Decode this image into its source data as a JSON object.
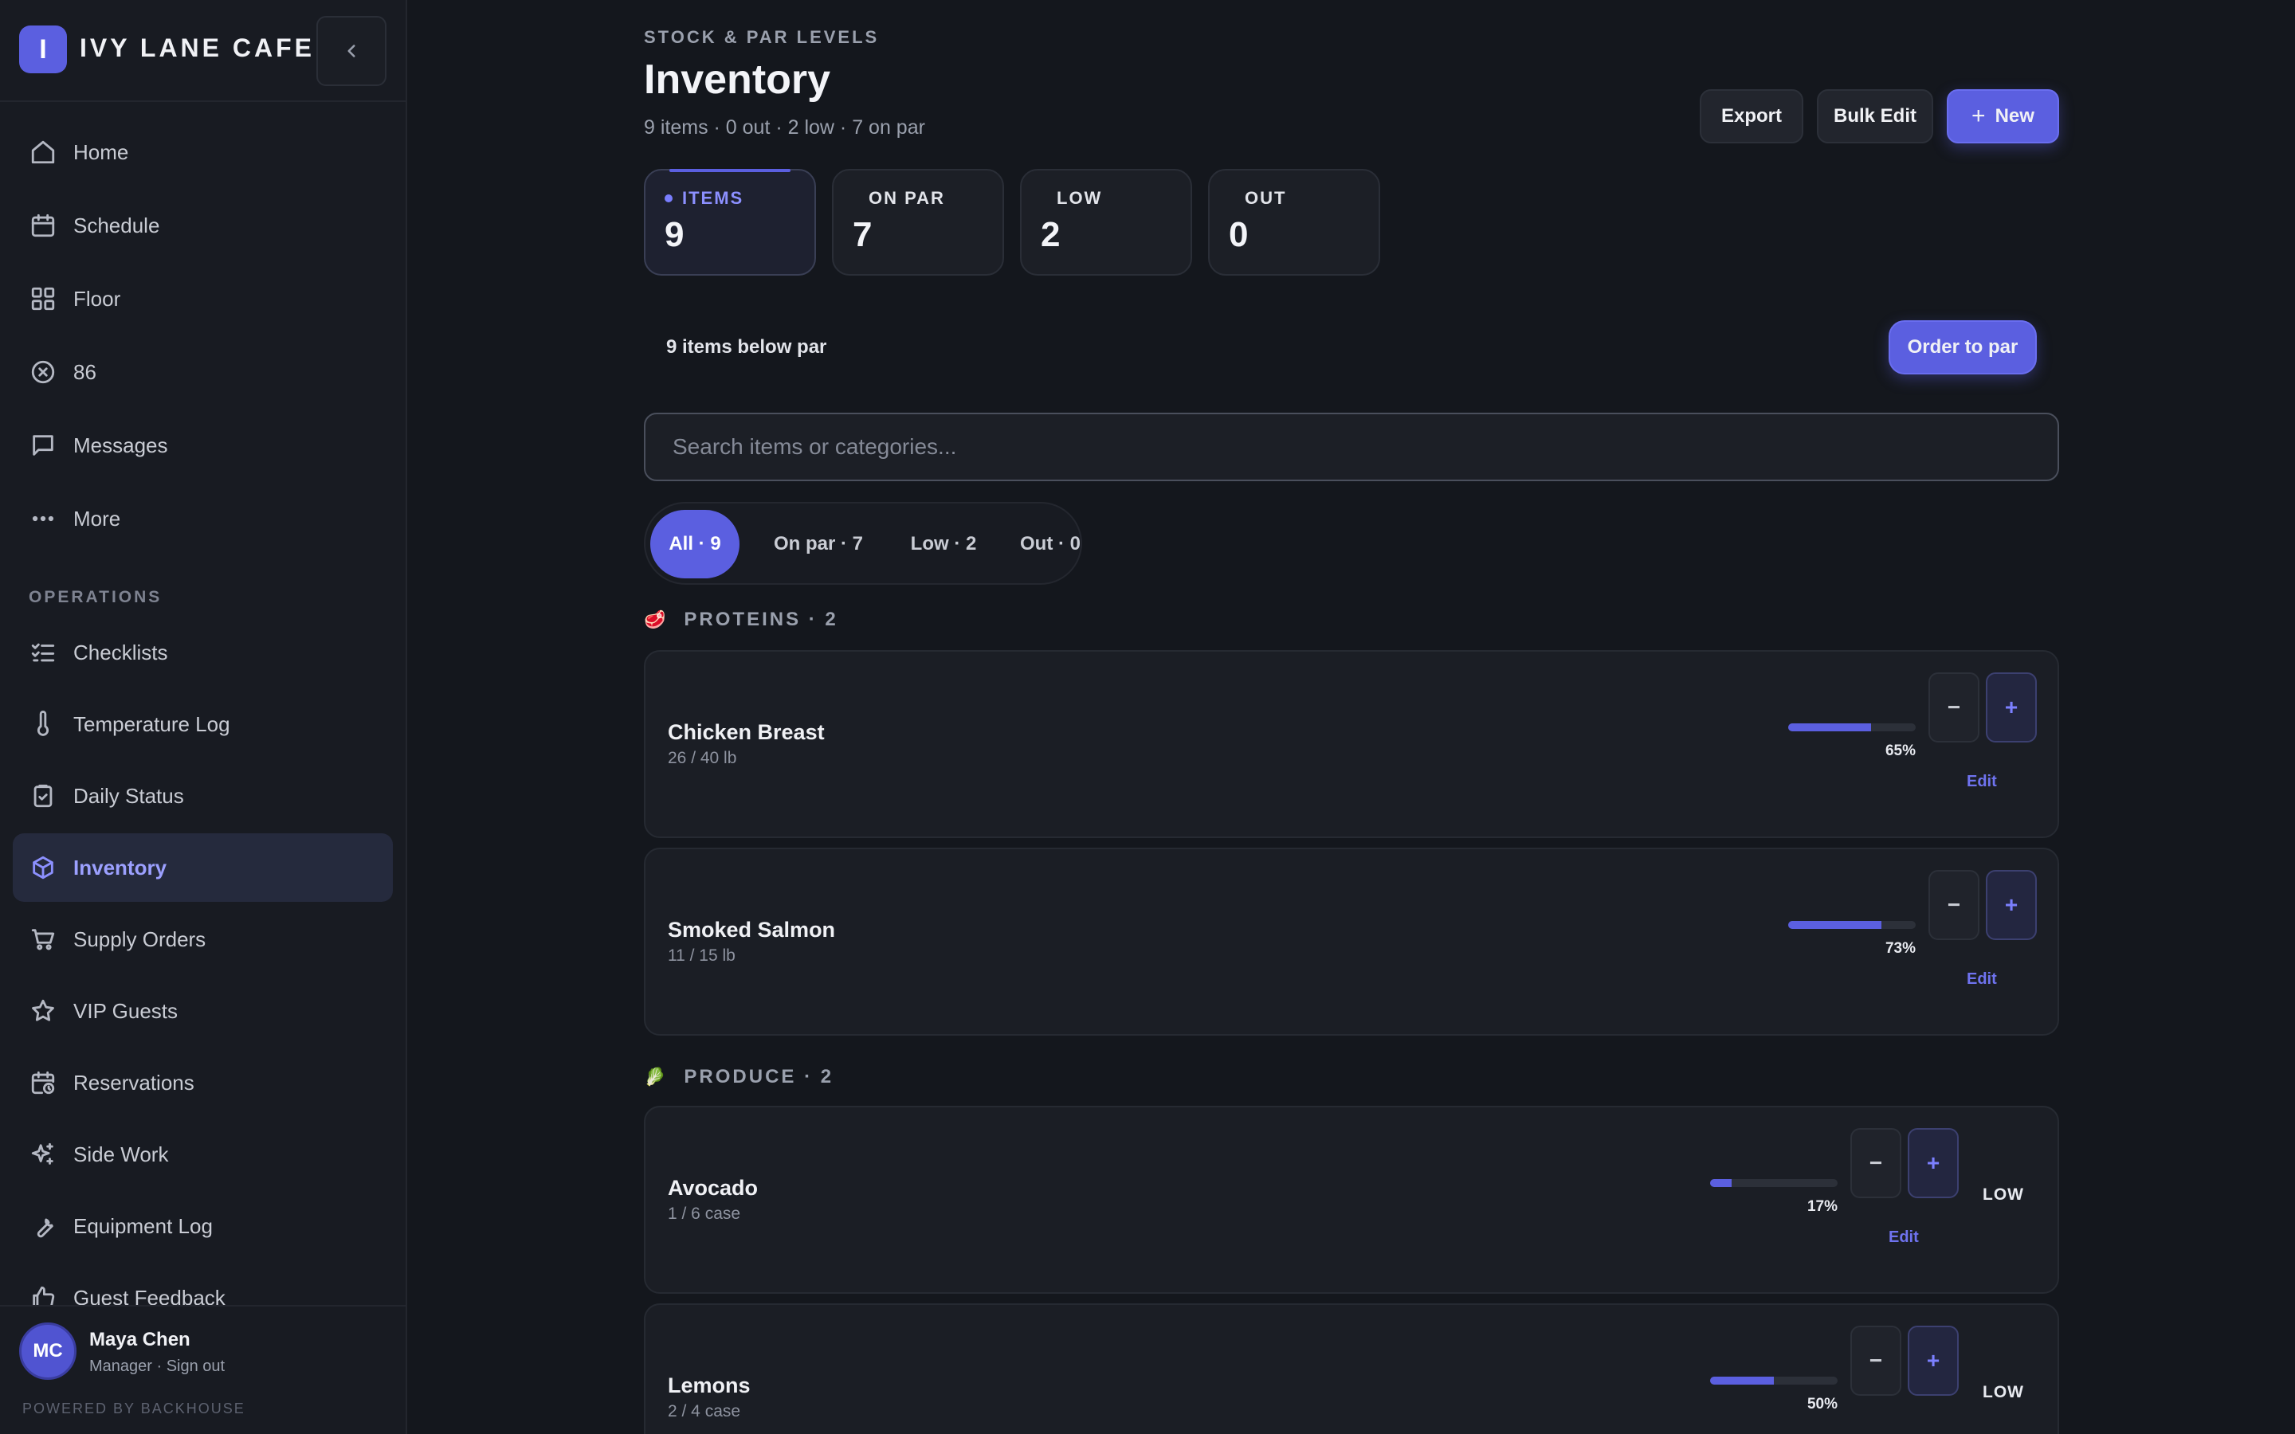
{
  "brand": {
    "logo_letter": "I",
    "name": "IVY LANE CAFE"
  },
  "sidebar": {
    "main_items": [
      {
        "label": "Home",
        "icon": "home-icon"
      },
      {
        "label": "Schedule",
        "icon": "calendar-icon"
      },
      {
        "label": "Floor",
        "icon": "grid-icon"
      },
      {
        "label": "86",
        "icon": "x-circle-icon"
      },
      {
        "label": "Messages",
        "icon": "message-icon"
      },
      {
        "label": "More",
        "icon": "more-icon"
      }
    ],
    "section_label": "OPERATIONS",
    "ops_items": [
      {
        "label": "Checklists",
        "icon": "checklist-icon"
      },
      {
        "label": "Temperature Log",
        "icon": "thermometer-icon"
      },
      {
        "label": "Daily Status",
        "icon": "clipboard-icon"
      },
      {
        "label": "Inventory",
        "icon": "box-icon",
        "active": true
      },
      {
        "label": "Supply Orders",
        "icon": "cart-icon"
      },
      {
        "label": "VIP Guests",
        "icon": "star-icon"
      },
      {
        "label": "Reservations",
        "icon": "calendar-clock-icon"
      },
      {
        "label": "Side Work",
        "icon": "sparkle-icon"
      },
      {
        "label": "Equipment Log",
        "icon": "wrench-icon"
      },
      {
        "label": "Guest Feedback",
        "icon": "thumbs-up-icon"
      }
    ]
  },
  "user": {
    "initials": "MC",
    "name": "Maya Chen",
    "role": "Manager · Sign out",
    "powered": "POWERED BY BACKHOUSE"
  },
  "header": {
    "eyebrow": "STOCK & PAR LEVELS",
    "title": "Inventory",
    "subtitle": "9 items · 0 out · 2 low · 7 on par",
    "export_label": "Export",
    "bulk_edit_label": "Bulk Edit",
    "new_label": "New"
  },
  "stats": [
    {
      "label": "ITEMS",
      "value": "9"
    },
    {
      "label": "ON PAR",
      "value": "7"
    },
    {
      "label": "LOW",
      "value": "2"
    },
    {
      "label": "OUT",
      "value": "0"
    }
  ],
  "below_par": {
    "text": "9 items below par",
    "button": "Order to par"
  },
  "search": {
    "placeholder": "Search items or categories..."
  },
  "filters": [
    "All · 9",
    "On par · 7",
    "Low · 2",
    "Out · 0"
  ],
  "categories": [
    {
      "emoji": "🥩",
      "label": "PROTEINS · 2"
    },
    {
      "emoji": "🥬",
      "label": "PRODUCE · 2"
    }
  ],
  "items": [
    {
      "name": "Chicken Breast",
      "qty": "26 / 40 lb",
      "pct": "65%",
      "fill": 0.65,
      "status": ""
    },
    {
      "name": "Smoked Salmon",
      "qty": "11 / 15 lb",
      "pct": "73%",
      "fill": 0.73,
      "status": ""
    },
    {
      "name": "Avocado",
      "qty": "1 / 6 case",
      "pct": "17%",
      "fill": 0.17,
      "status": "LOW"
    },
    {
      "name": "Lemons",
      "qty": "2 / 4 case",
      "pct": "50%",
      "fill": 0.5,
      "status": "LOW"
    }
  ],
  "labels": {
    "minus": "−",
    "plus": "+",
    "edit": "Edit"
  }
}
